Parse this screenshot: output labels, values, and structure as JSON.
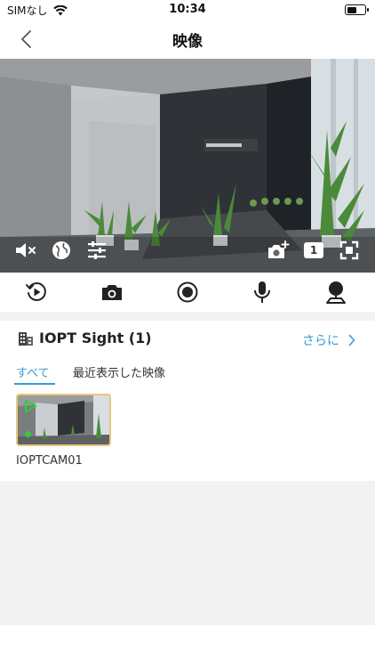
{
  "status_bar": {
    "carrier": "SIMなし",
    "time": "10:34",
    "battery_level": 0.55
  },
  "nav": {
    "title": "映像",
    "back_icon": "chevron-left-icon"
  },
  "video": {
    "overlay_controls": [
      {
        "name": "mute-icon"
      },
      {
        "name": "globe-icon"
      },
      {
        "name": "stream-quality-icon"
      },
      {
        "name": "snapshot-plus-icon"
      },
      {
        "name": "channel-badge",
        "label": "1"
      },
      {
        "name": "fullscreen-icon"
      }
    ]
  },
  "controls": [
    {
      "name": "playback-icon"
    },
    {
      "name": "camera-icon"
    },
    {
      "name": "record-icon"
    },
    {
      "name": "microphone-icon"
    },
    {
      "name": "ptz-icon"
    }
  ],
  "group": {
    "title": "IOPT Sight (1)",
    "icon": "building-icon",
    "more_label": "さらに"
  },
  "tabs": {
    "all": "すべて",
    "recent": "最近表示した映像"
  },
  "camera": {
    "name": "IOPTCAM01",
    "status_color": "#2ecc40"
  },
  "colors": {
    "accent": "#3a9bd8",
    "thumbnail_border": "#e8c77a"
  }
}
